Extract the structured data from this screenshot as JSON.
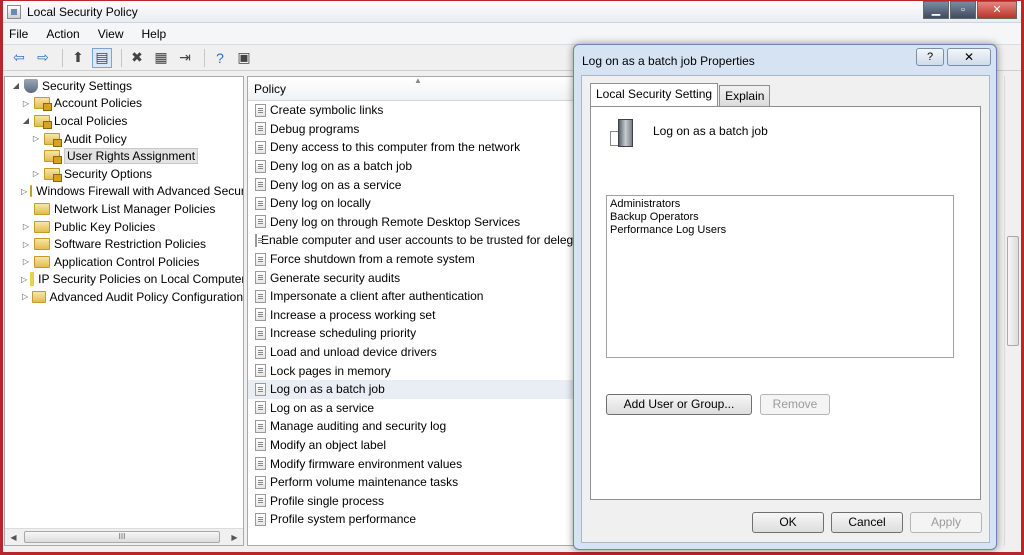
{
  "window": {
    "title": "Local Security Policy"
  },
  "menu": [
    "File",
    "Action",
    "View",
    "Help"
  ],
  "toolbar": {
    "back_glyph": "⇦",
    "forward_glyph": "⇨",
    "up_glyph": "⬆",
    "show_tree_glyph": "▤",
    "delete_glyph": "✖",
    "properties_glyph": "▦",
    "export_glyph": "⇥",
    "help_glyph": "?",
    "console_glyph": "▣"
  },
  "tree": {
    "items": [
      {
        "label": "Security Settings",
        "level": 0,
        "expanded": "open"
      },
      {
        "label": "Account Policies",
        "level": 1,
        "expanded": "closed"
      },
      {
        "label": "Local Policies",
        "level": 1,
        "expanded": "open"
      },
      {
        "label": "Audit Policy",
        "level": 2,
        "expanded": "closed"
      },
      {
        "label": "User Rights Assignment",
        "level": 2,
        "expanded": "none",
        "selected": true
      },
      {
        "label": "Security Options",
        "level": 2,
        "expanded": "closed"
      },
      {
        "label": "Windows Firewall with Advanced Security",
        "level": 1,
        "expanded": "closed"
      },
      {
        "label": "Network List Manager Policies",
        "level": 1,
        "expanded": "none"
      },
      {
        "label": "Public Key Policies",
        "level": 1,
        "expanded": "closed"
      },
      {
        "label": "Software Restriction Policies",
        "level": 1,
        "expanded": "closed"
      },
      {
        "label": "Application Control Policies",
        "level": 1,
        "expanded": "closed"
      },
      {
        "label": "IP Security Policies on Local Computer",
        "level": 1,
        "expanded": "closed"
      },
      {
        "label": "Advanced Audit Policy Configuration",
        "level": 1,
        "expanded": "closed"
      }
    ],
    "scroll_thumb_glyph": "III"
  },
  "list": {
    "header": "Policy",
    "items": [
      "Create symbolic links",
      "Debug programs",
      "Deny access to this computer from the network",
      "Deny log on as a batch job",
      "Deny log on as a service",
      "Deny log on locally",
      "Deny log on through Remote Desktop Services",
      "Enable computer and user accounts to be trusted for delegation",
      "Force shutdown from a remote system",
      "Generate security audits",
      "Impersonate a client after authentication",
      "Increase a process working set",
      "Increase scheduling priority",
      "Load and unload device drivers",
      "Lock pages in memory",
      "Log on as a batch job",
      "Log on as a service",
      "Manage auditing and security log",
      "Modify an object label",
      "Modify firmware environment values",
      "Perform volume maintenance tasks",
      "Profile single process",
      "Profile system performance"
    ],
    "selected_index": 15
  },
  "dialog": {
    "title": "Log on as a batch job Properties",
    "help_label": "?",
    "close_label": "✕",
    "tabs": [
      "Local Security Setting",
      "Explain"
    ],
    "active_tab": 0,
    "policy_name": "Log on as a batch job",
    "members": [
      "Administrators",
      "Backup Operators",
      "Performance Log Users"
    ],
    "add_button": "Add User or Group...",
    "remove_button": "Remove",
    "ok_button": "OK",
    "cancel_button": "Cancel",
    "apply_button": "Apply"
  },
  "colors": {
    "frame_accent": "#b8262b",
    "selection": "#e9eef5"
  }
}
